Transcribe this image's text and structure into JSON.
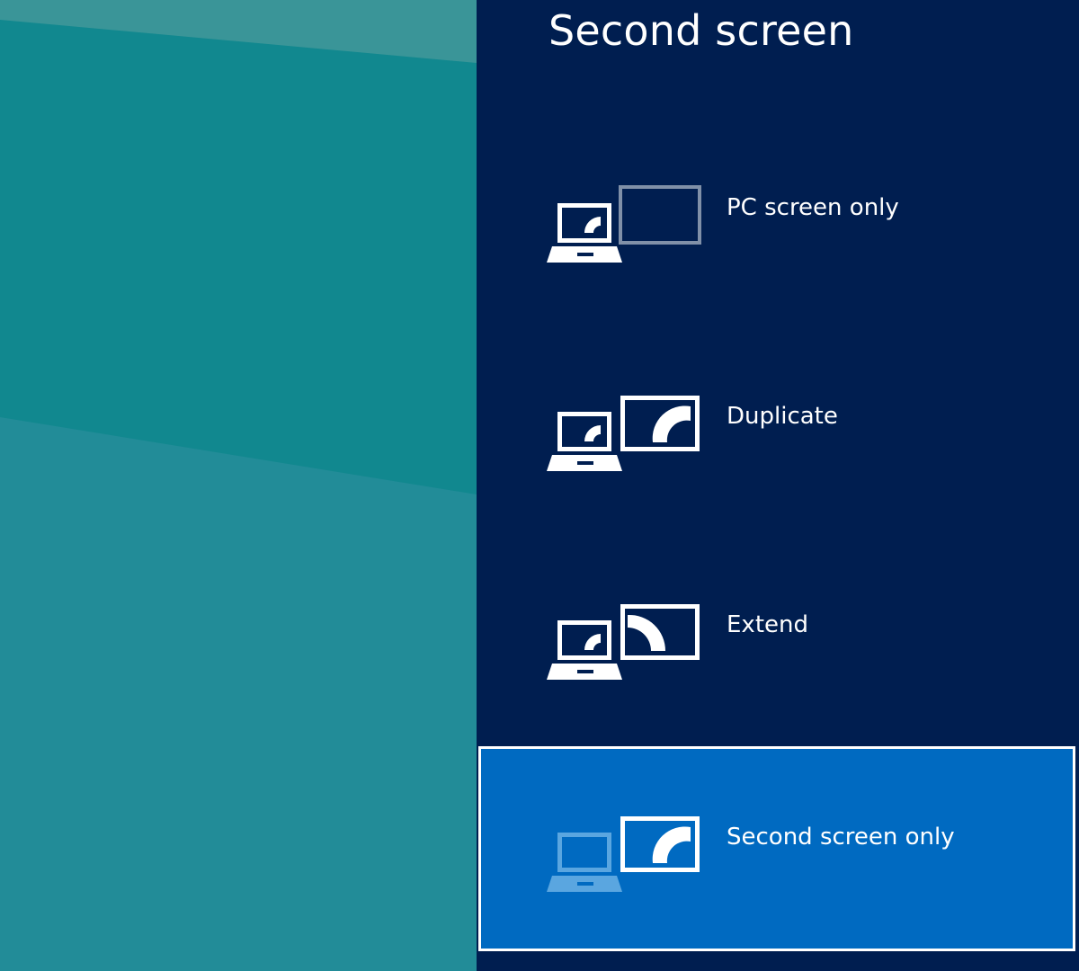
{
  "panel": {
    "title": "Second screen",
    "options": [
      {
        "label": "PC screen only",
        "icon": "pc-screen-only-icon"
      },
      {
        "label": "Duplicate",
        "icon": "duplicate-icon"
      },
      {
        "label": "Extend",
        "icon": "extend-icon"
      },
      {
        "label": "Second screen only",
        "icon": "second-screen-only-icon",
        "selected": true
      }
    ]
  },
  "colors": {
    "desktop_teal": "#11888f",
    "panel_background": "#001e50",
    "selected_background": "#006ac1",
    "text": "#ffffff"
  }
}
